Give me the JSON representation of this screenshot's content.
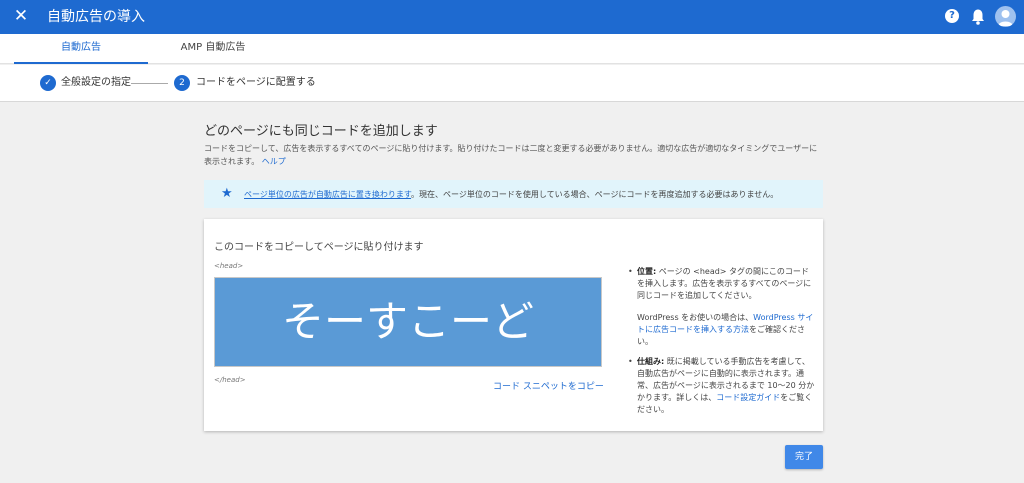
{
  "app": {
    "title": "自動広告の導入",
    "help_icon_glyph": "?"
  },
  "tabs": [
    {
      "label": "自動広告",
      "active": true
    },
    {
      "label": "AMP 自動広告",
      "active": false
    }
  ],
  "stepper": {
    "steps": [
      {
        "label": "全般設定の指定",
        "status": "completed",
        "marker": "✓"
      },
      {
        "label": "コードをページに配置する",
        "status": "current",
        "marker": "2"
      }
    ]
  },
  "main": {
    "heading": "どのページにも同じコードを追加します",
    "description_line1": "コードをコピーして、広告を表示するすべてのページに貼り付けます。貼り付けたコードは二度と変更する必要がありません。適切な広告が適切なタイミングでユーザーに",
    "description_line2": "表示されます。",
    "help_link": "ヘルプ"
  },
  "banner": {
    "icon": "star-icon",
    "link_text": "ページ単位の広告が自動広告に置き換わります",
    "text": "。現在、ページ単位のコードを使用している場合、ページにコードを再度追加する必要はありません。"
  },
  "card": {
    "title": "このコードをコピーしてページに貼り付けます",
    "head_open": "<head>",
    "head_close": "</head>",
    "code_text": "そーすこーど",
    "copy_button": "コード スニペットをコピー",
    "notes": {
      "location_label": "位置:",
      "location_text": " ページの <head> タグの間にこのコードを挿入します。広告を表示するすべてのページに同じコードを追加してください。",
      "wordpress_prefix": "WordPress をお使いの場合は、",
      "wordpress_link": "WordPress サイトに広告コードを挿入する方法",
      "wordpress_suffix": "をご確認ください。",
      "mechanism_label": "仕組み:",
      "mechanism_text": " 既に掲載している手動広告を考慮して、自動広告がページに自動的に表示されます。通常、広告がページに表示されるまで 10〜20 分かかります。詳しくは、",
      "guide_link": "コード設定ガイド",
      "guide_suffix": "をご覧ください。"
    }
  },
  "footer": {
    "done_button": "完了"
  },
  "colors": {
    "brand": "#1e6ad0",
    "code_box": "#5a9ad6",
    "banner_bg": "#e1f4fb",
    "button": "#4088e8"
  }
}
